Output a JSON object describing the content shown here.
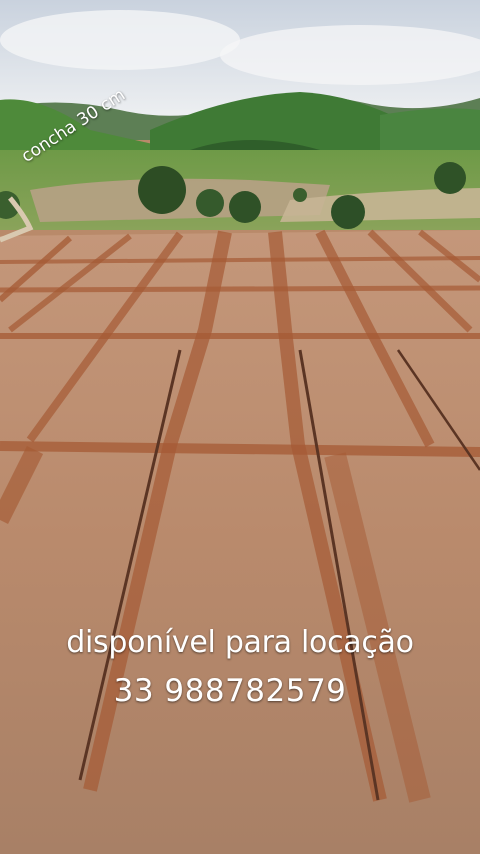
{
  "photo": {
    "description_icon": "aerial-field-photo",
    "colors": {
      "sky": "#dfe4ea",
      "hills": "#3f7a35",
      "soil": "#b98a6a",
      "furrow": "#a0552f"
    }
  },
  "overlay": {
    "rotated_label": "concha 30 cm",
    "caption_line1": "disponível para locação",
    "caption_line2": "33 988782579"
  }
}
